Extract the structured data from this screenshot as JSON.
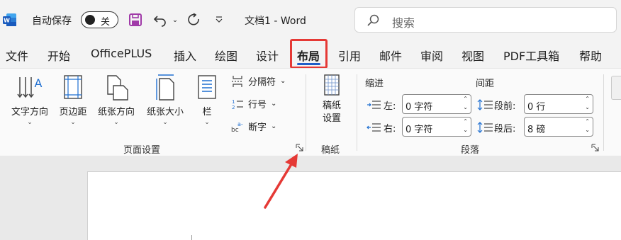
{
  "titlebar": {
    "autosave_label": "自动保存",
    "autosave_state": "关",
    "doc_title": "文档1  -  Word",
    "search_placeholder": "搜索"
  },
  "tabs": [
    {
      "label": "文件"
    },
    {
      "label": "开始"
    },
    {
      "label": "OfficePLUS"
    },
    {
      "label": "插入"
    },
    {
      "label": "绘图"
    },
    {
      "label": "设计"
    },
    {
      "label": "布局",
      "active": true
    },
    {
      "label": "引用"
    },
    {
      "label": "邮件"
    },
    {
      "label": "审阅"
    },
    {
      "label": "视图"
    },
    {
      "label": "PDF工具箱"
    },
    {
      "label": "帮助"
    }
  ],
  "ribbon": {
    "page_setup": {
      "text_direction": "文字方向",
      "margins": "页边距",
      "orientation": "纸张方向",
      "size": "纸张大小",
      "columns": "栏",
      "breaks": "分隔符",
      "line_numbers": "行号",
      "hyphenation": "断字",
      "group_label": "页面设置"
    },
    "manuscript": {
      "button": "稿纸\n设置",
      "button_line1": "稿纸",
      "button_line2": "设置",
      "group_label": "稿纸"
    },
    "paragraph": {
      "indent_title": "缩进",
      "spacing_title": "间距",
      "left_label": "左:",
      "left_value": "0 字符",
      "right_label": "右:",
      "right_value": "0 字符",
      "before_label": "段前:",
      "before_value": "0 行",
      "after_label": "段后:",
      "after_value": "8 磅",
      "group_label": "段落"
    }
  },
  "colors": {
    "accent": "#1f5ec8",
    "highlight": "#e53935",
    "word_blue": "#185abd"
  }
}
